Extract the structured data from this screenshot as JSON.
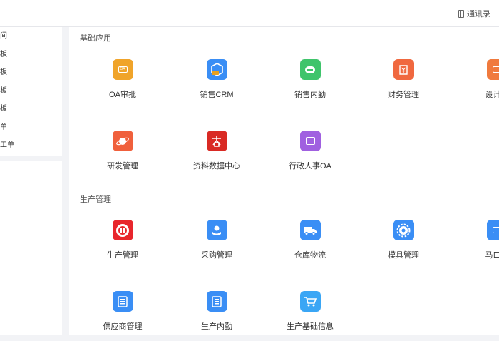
{
  "topbar": {
    "contacts_label": "通讯录"
  },
  "sidebar": {
    "items": [
      "间",
      "板",
      "板",
      "板",
      "板",
      "单",
      "工单"
    ]
  },
  "sections": [
    {
      "title": "基础应用",
      "apps": [
        {
          "label": "OA审批",
          "icon": "oa-approval-icon",
          "color": "#f0a42a"
        },
        {
          "label": "销售CRM",
          "icon": "sales-crm-icon",
          "color": "#3a8ef5"
        },
        {
          "label": "销售内勤",
          "icon": "sales-office-icon",
          "color": "#3fc46b"
        },
        {
          "label": "财务管理",
          "icon": "finance-icon",
          "color": "#f0683f"
        },
        {
          "label": "设计管",
          "icon": "design-icon",
          "color": "#f07a3d"
        },
        {
          "label": "研发管理",
          "icon": "rnd-planet-icon",
          "color": "#f0603c"
        },
        {
          "label": "资料数据中心",
          "icon": "data-center-icon",
          "color": "#d92a24"
        },
        {
          "label": "行政人事OA",
          "icon": "admin-hr-icon",
          "color": "#a060e0"
        }
      ]
    },
    {
      "title": "生产管理",
      "apps": [
        {
          "label": "生产管理",
          "icon": "production-icon",
          "color": "#e8262c"
        },
        {
          "label": "采购管理",
          "icon": "purchase-icon",
          "color": "#3a8ef5"
        },
        {
          "label": "仓库物流",
          "icon": "warehouse-truck-icon",
          "color": "#3a8ef5"
        },
        {
          "label": "模具管理",
          "icon": "mold-icon",
          "color": "#3a8ef5"
        },
        {
          "label": "马口铁",
          "icon": "tinplate-icon",
          "color": "#3a8ef5"
        },
        {
          "label": "供应商管理",
          "icon": "supplier-icon",
          "color": "#3a8ef5"
        },
        {
          "label": "生产内勤",
          "icon": "production-office-icon",
          "color": "#3a8ef5"
        },
        {
          "label": "生产基础信息",
          "icon": "cart-icon",
          "color": "#3aa6f5"
        }
      ]
    }
  ]
}
